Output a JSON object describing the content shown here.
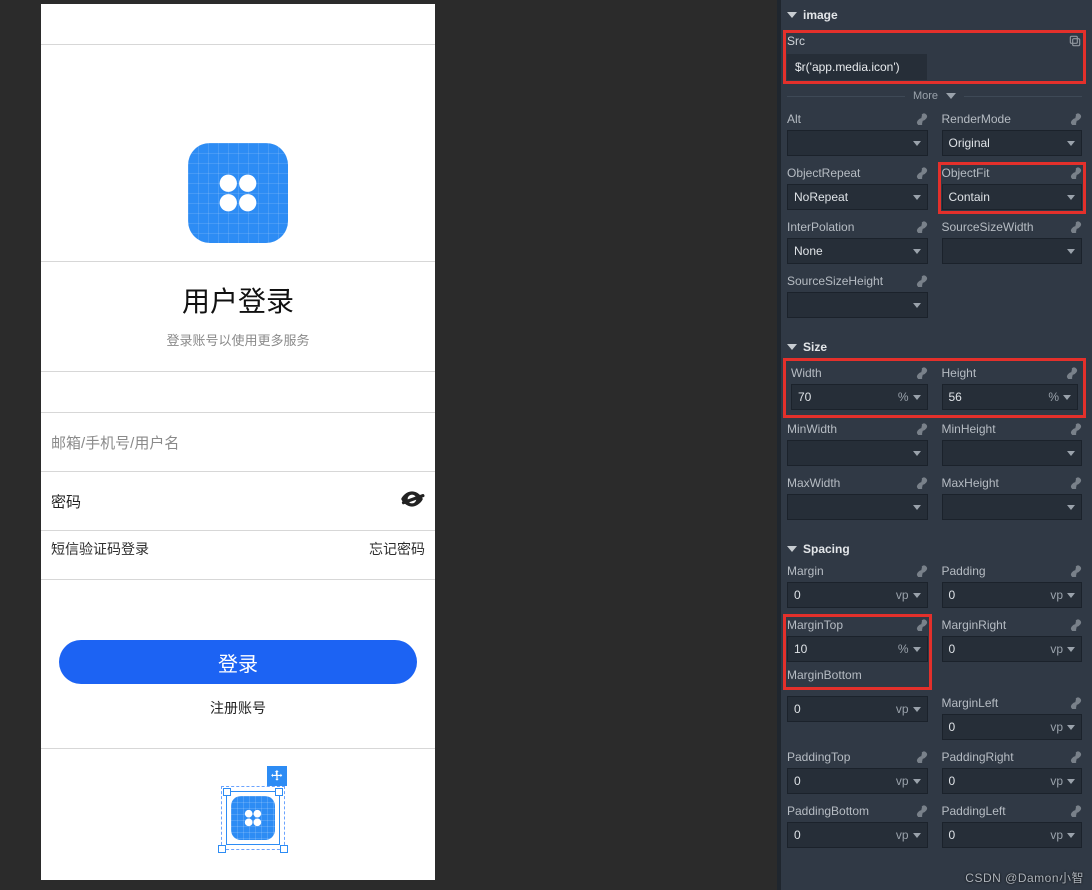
{
  "preview": {
    "title": "用户登录",
    "subtitle": "登录账号以使用更多服务",
    "account_placeholder": "邮箱/手机号/用户名",
    "password_placeholder": "密码",
    "sms_login": "短信验证码登录",
    "forgot": "忘记密码",
    "login_btn": "登录",
    "register": "注册账号"
  },
  "inspector": {
    "section_image": "image",
    "src_label": "Src",
    "src_value": "$r('app.media.icon')",
    "more": "More",
    "fields": {
      "alt": {
        "label": "Alt",
        "value": ""
      },
      "renderMode": {
        "label": "RenderMode",
        "value": "Original"
      },
      "objectRepeat": {
        "label": "ObjectRepeat",
        "value": "NoRepeat"
      },
      "objectFit": {
        "label": "ObjectFit",
        "value": "Contain"
      },
      "interpolation": {
        "label": "InterPolation",
        "value": "None"
      },
      "sourceSizeWidth": {
        "label": "SourceSizeWidth",
        "value": ""
      },
      "sourceSizeHeight": {
        "label": "SourceSizeHeight",
        "value": ""
      }
    },
    "section_size": "Size",
    "size": {
      "width": {
        "label": "Width",
        "value": "70",
        "unit": "%"
      },
      "height": {
        "label": "Height",
        "value": "56",
        "unit": "%"
      },
      "minWidth": {
        "label": "MinWidth",
        "value": ""
      },
      "minHeight": {
        "label": "MinHeight",
        "value": ""
      },
      "maxWidth": {
        "label": "MaxWidth",
        "value": ""
      },
      "maxHeight": {
        "label": "MaxHeight",
        "value": ""
      }
    },
    "section_spacing": "Spacing",
    "spacing": {
      "margin": {
        "label": "Margin",
        "value": "0",
        "unit": "vp"
      },
      "padding": {
        "label": "Padding",
        "value": "0",
        "unit": "vp"
      },
      "marginTop": {
        "label": "MarginTop",
        "value": "10",
        "unit": "%"
      },
      "marginRight": {
        "label": "MarginRight",
        "value": "0",
        "unit": "vp"
      },
      "marginBottom": {
        "label": "MarginBottom",
        "value": "0",
        "unit": "vp"
      },
      "marginLeft": {
        "label": "MarginLeft",
        "value": "0",
        "unit": "vp"
      },
      "paddingTop": {
        "label": "PaddingTop",
        "value": "0",
        "unit": "vp"
      },
      "paddingRight": {
        "label": "PaddingRight",
        "value": "0",
        "unit": "vp"
      },
      "paddingBottom": {
        "label": "PaddingBottom",
        "value": "0",
        "unit": "vp"
      },
      "paddingLeft": {
        "label": "PaddingLeft",
        "value": "0",
        "unit": "vp"
      }
    }
  },
  "watermark": "CSDN @Damon小智"
}
